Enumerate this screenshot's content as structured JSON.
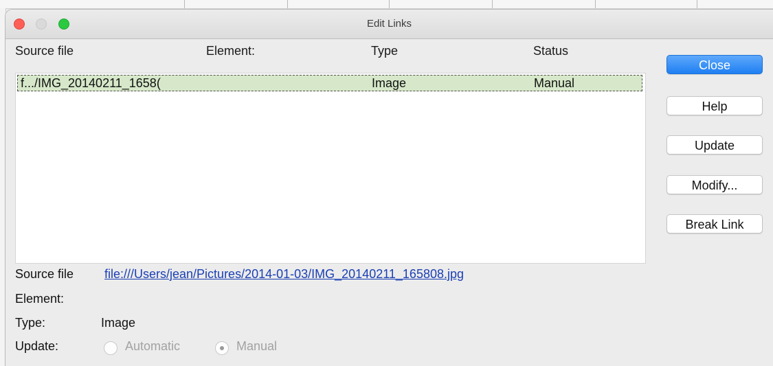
{
  "window": {
    "title": "Edit Links"
  },
  "list": {
    "columns": [
      "Source file",
      "Element:",
      "Type",
      "Status"
    ],
    "rows": [
      {
        "source": "f.../IMG_20140211_1658(",
        "element": "",
        "type": "Image",
        "status": "Manual",
        "selected": true
      }
    ]
  },
  "buttons": {
    "close": "Close",
    "help": "Help",
    "update": "Update",
    "modify": "Modify...",
    "break_link": "Break Link"
  },
  "details": {
    "source_label": "Source file",
    "source_value": "file:///Users/jean/Pictures/2014-01-03/IMG_20140211_165808.jpg",
    "element_label": "Element:",
    "element_value": "",
    "type_label": "Type:",
    "type_value": "Image",
    "update_label": "Update:",
    "update_options": [
      "Automatic",
      "Manual"
    ],
    "update_selected": "Manual"
  },
  "colors": {
    "selection": "#d6e8c9",
    "primary_button": "#1f7ff2",
    "link": "#1a3fb4"
  }
}
